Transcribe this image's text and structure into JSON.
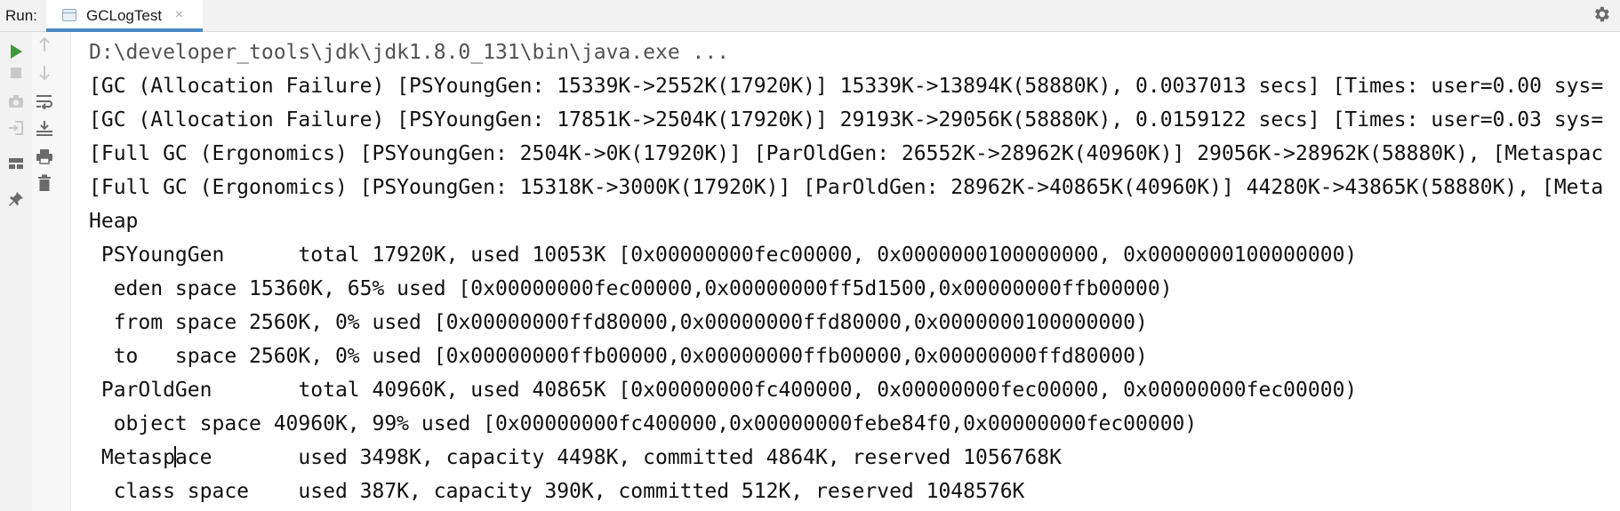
{
  "toolbar": {
    "run_label": "Run:",
    "tab_title": "GCLogTest",
    "tab_close": "×",
    "settings_icon": "gear-icon"
  },
  "gutter": {
    "icons": [
      "run-icon",
      "stop-icon",
      "camera-icon",
      "login-icon",
      "layout-icon",
      "pin-icon",
      "up-arrow-icon",
      "down-arrow-icon",
      "soft-wrap-icon",
      "scroll-to-end-icon",
      "print-icon",
      "trash-icon"
    ]
  },
  "colors": {
    "run_green": "#3f9a3f",
    "tab_underline": "#4a88c7",
    "console_text": "#111111"
  },
  "console": {
    "lines": [
      "D:\\developer_tools\\jdk\\jdk1.8.0_131\\bin\\java.exe ...",
      "[GC (Allocation Failure) [PSYoungGen: 15339K->2552K(17920K)] 15339K->13894K(58880K), 0.0037013 secs] [Times: user=0.00 sys=",
      "[GC (Allocation Failure) [PSYoungGen: 17851K->2504K(17920K)] 29193K->29056K(58880K), 0.0159122 secs] [Times: user=0.03 sys=",
      "[Full GC (Ergonomics) [PSYoungGen: 2504K->0K(17920K)] [ParOldGen: 26552K->28962K(40960K)] 29056K->28962K(58880K), [Metaspac",
      "[Full GC (Ergonomics) [PSYoungGen: 15318K->3000K(17920K)] [ParOldGen: 28962K->40865K(40960K)] 44280K->43865K(58880K), [Meta",
      "Heap",
      " PSYoungGen      total 17920K, used 10053K [0x00000000fec00000, 0x0000000100000000, 0x0000000100000000)",
      "  eden space 15360K, 65% used [0x00000000fec00000,0x00000000ff5d1500,0x00000000ffb00000)",
      "  from space 2560K, 0% used [0x00000000ffd80000,0x00000000ffd80000,0x0000000100000000)",
      "  to   space 2560K, 0% used [0x00000000ffb00000,0x00000000ffb00000,0x00000000ffd80000)",
      " ParOldGen       total 40960K, used 40865K [0x00000000fc400000, 0x00000000fec00000, 0x00000000fec00000)",
      "  object space 40960K, 99% used [0x00000000fc400000,0x00000000febe84f0,0x00000000fec00000)"
    ],
    "metaspace_head": " Metasp",
    "metaspace_tail": "ace       used 3498K, capacity 4498K, committed 4864K, reserved 1056768K",
    "class_space_line": "  class space    used 387K, capacity 390K, committed 512K, reserved 1048576K"
  }
}
